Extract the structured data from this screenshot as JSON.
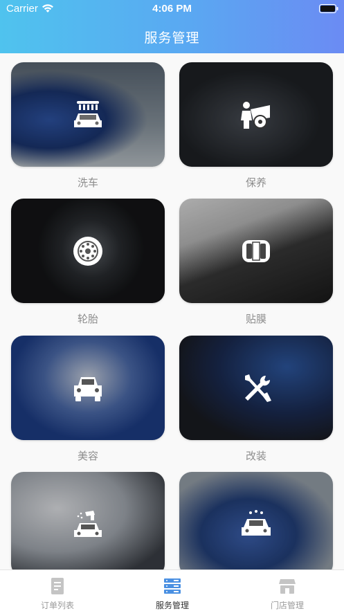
{
  "status_bar": {
    "carrier": "Carrier",
    "time": "4:06 PM"
  },
  "header": {
    "title": "服务管理"
  },
  "services": [
    {
      "label": "洗车",
      "icon": "car-wash-icon"
    },
    {
      "label": "保养",
      "icon": "maintenance-icon"
    },
    {
      "label": "轮胎",
      "icon": "tire-icon"
    },
    {
      "label": "贴膜",
      "icon": "film-icon"
    },
    {
      "label": "美容",
      "icon": "car-beauty-icon"
    },
    {
      "label": "改装",
      "icon": "tools-icon"
    },
    {
      "label": "",
      "icon": "spray-paint-icon"
    },
    {
      "label": "",
      "icon": "car-clean-icon"
    }
  ],
  "tabbar": {
    "tabs": [
      {
        "label": "订单列表",
        "icon": "document-icon",
        "active": false
      },
      {
        "label": "服务管理",
        "icon": "server-list-icon",
        "active": true
      },
      {
        "label": "门店管理",
        "icon": "store-icon",
        "active": false
      }
    ]
  },
  "colors": {
    "header_gradient_start": "#4fc3ee",
    "header_gradient_end": "#6b8bf3",
    "active_tab_icon": "#4a90e2",
    "inactive_tab_icon": "#c4c4c4",
    "label_gray": "#8d8d8d"
  }
}
